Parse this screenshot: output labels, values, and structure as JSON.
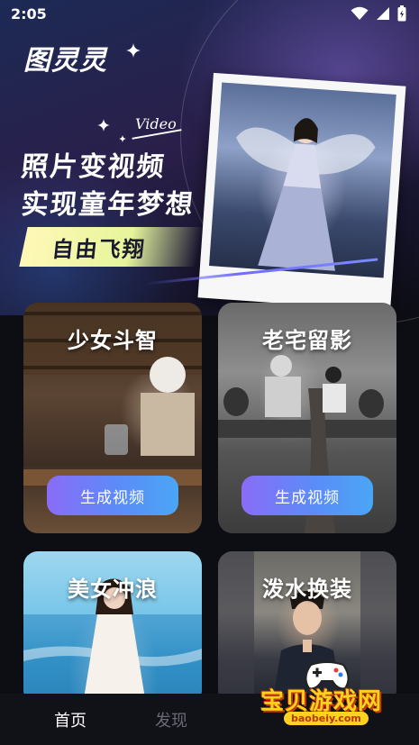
{
  "status_bar": {
    "time": "2:05",
    "icons": [
      "wifi-icon",
      "signal-icon",
      "battery-icon"
    ]
  },
  "app": {
    "logo": "图灵灵"
  },
  "hero": {
    "video_tag": "Video",
    "headline_line1": "照片变视频",
    "headline_line2": "实现童年梦想",
    "banner": "自由飞翔"
  },
  "cards": [
    {
      "title": "少女斗智",
      "button": "生成视频"
    },
    {
      "title": "老宅留影",
      "button": "生成视频"
    },
    {
      "title": "美女冲浪"
    },
    {
      "title": "泼水换装"
    }
  ],
  "bottom_nav": {
    "items": [
      {
        "label": "首页",
        "active": true
      },
      {
        "label": "发现",
        "active": false
      }
    ]
  },
  "watermark": {
    "text": "宝贝游戏网",
    "url": "baobeiy.com"
  },
  "colors": {
    "accent_gradient_start": "#8a6cf7",
    "accent_gradient_end": "#4aa6f5",
    "banner_yellow": "#e6f59a",
    "background": "#0d0d14"
  }
}
